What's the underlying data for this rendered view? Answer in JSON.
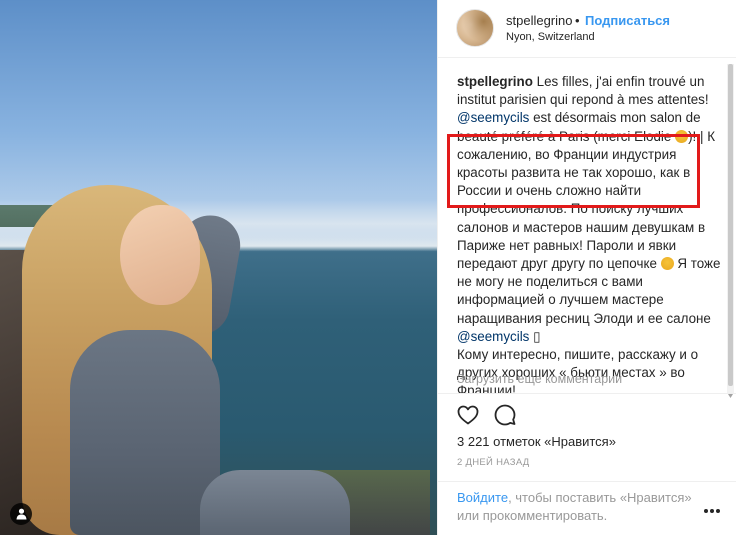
{
  "header": {
    "username": "stpellegrino",
    "separator": "•",
    "follow_label": "Подписаться",
    "location": "Nyon, Switzerland"
  },
  "caption": {
    "username": "stpellegrino",
    "text_fr_1": "Les filles, j'ai enfin trouvé un institut parisien qui repond à mes attentes!",
    "mention_1": "@seemycils",
    "text_fr_2": "est désormais mon salon de beauté préféré à Paris (merci Elodie",
    "text_fr_3": ")! |",
    "text_ru_highlight": "К сожалению, во Франции индустрия красоты развита не так хорошо, как в России и очень сложно найти профессионалов.",
    "text_ru_2": "По поиску лучших салонов и мастеров нашим девушкам в Париже нет равных! Пароли и явки передают друг другу по цепочке",
    "text_ru_3": "Я тоже не могу не поделиться с вами информацией о лучшем мастере наращивания ресниц Элоди и ее салоне",
    "mention_2": "@seemycils",
    "text_ru_3_end": "▯",
    "text_ru_4": "Кому интересно, пишите, расскажу и о других хороших « бьюти местах » во Франции!"
  },
  "load_more_label": "Загрузить еще комментарии",
  "likes_label": "3 221 отметок «Нравится»",
  "time_label": "2 ДНЕЙ НАЗАД",
  "login": {
    "link": "Войдите",
    "rest": ", чтобы поставить «Нравится» или прокомментировать."
  },
  "colors": {
    "accent": "#3897f0",
    "mention": "#003569",
    "highlight_box": "#e21a1a",
    "muted": "#999999"
  },
  "icons": {
    "like": "heart-outline-icon",
    "comment": "speech-bubble-icon",
    "more": "ellipsis-icon",
    "user_tag": "user-tag-icon"
  }
}
